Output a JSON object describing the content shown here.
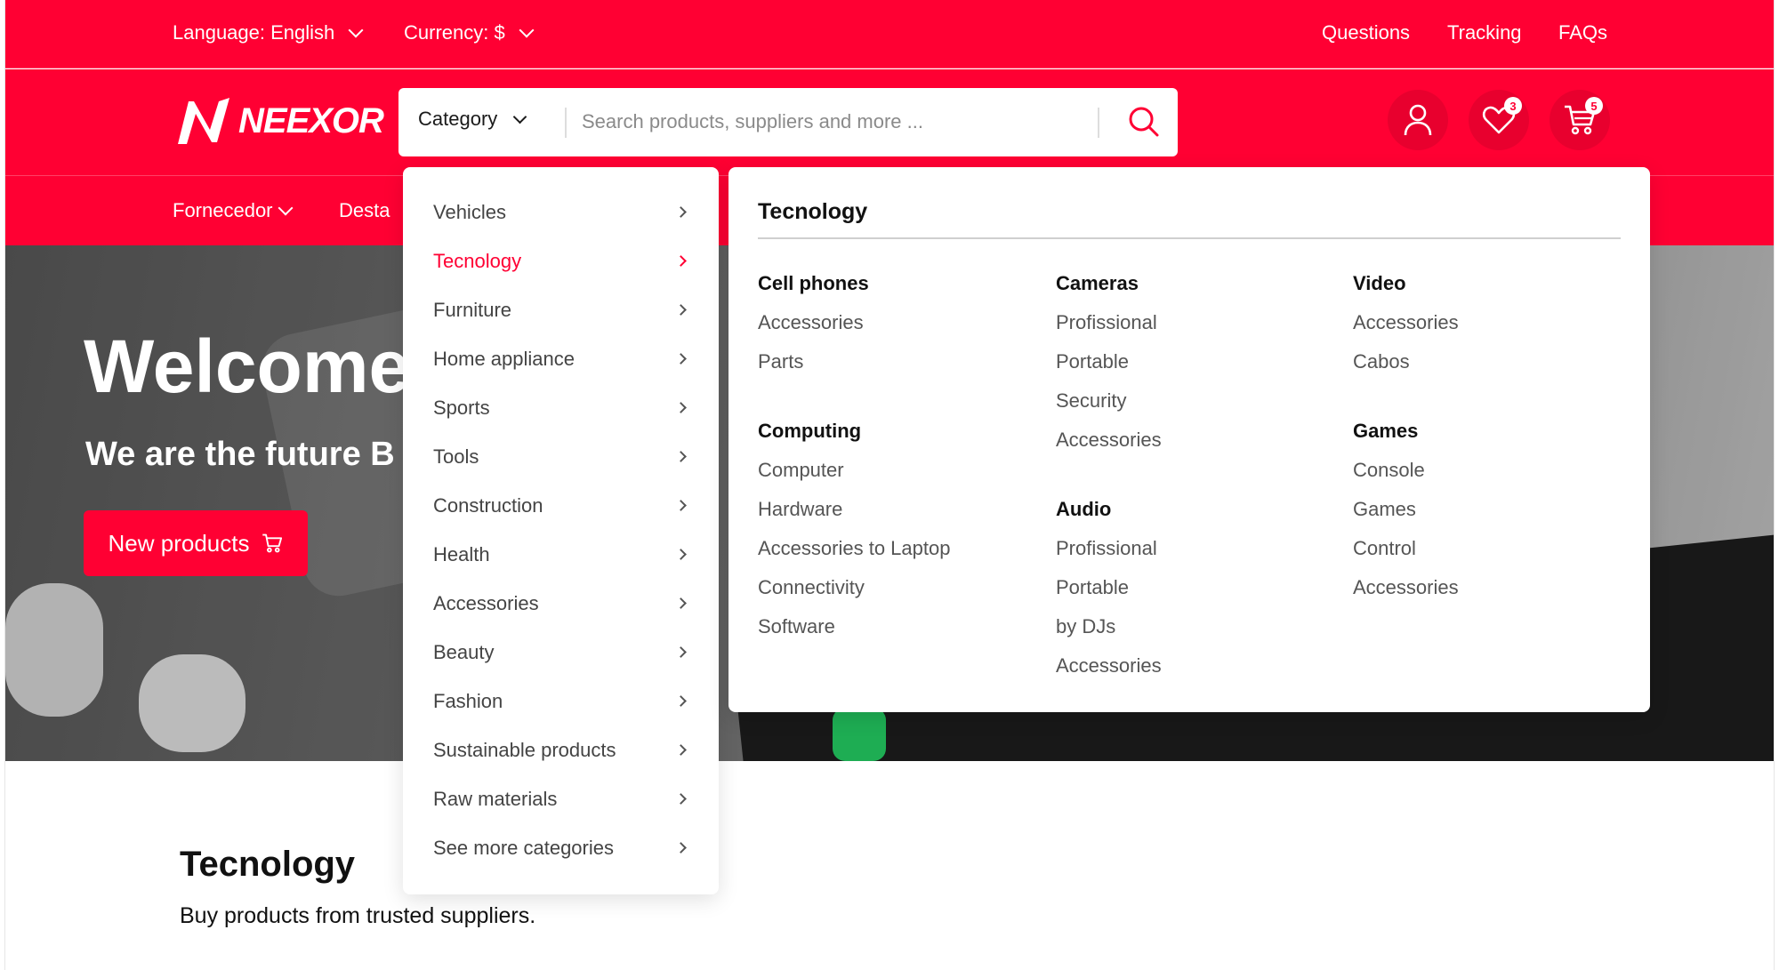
{
  "topbar": {
    "language": "Language: English",
    "currency": "Currency: $",
    "links": [
      "Questions",
      "Tracking",
      "FAQs"
    ]
  },
  "header": {
    "logo": "NEEXOR",
    "category_button": "Category",
    "search_placeholder": "Search products, suppliers and more ...",
    "wishlist_count": "3",
    "cart_count": "5"
  },
  "nav": {
    "items": [
      "Fornecedor",
      "Desta"
    ]
  },
  "hero": {
    "title": "Welcome",
    "subtitle": "We are the future B",
    "button": "New products"
  },
  "category_menu": {
    "items": [
      "Vehicles",
      "Tecnology",
      "Furniture",
      "Home appliance",
      "Sports",
      "Tools",
      "Construction",
      "Health",
      "Accessories",
      "Beauty",
      "Fashion",
      "Sustainable products",
      "Raw materials",
      "See more categories"
    ],
    "active": "Tecnology"
  },
  "mega_menu": {
    "title": "Tecnology",
    "groups": {
      "cell_phones": {
        "heading": "Cell phones",
        "links": [
          "Accessories",
          "Parts"
        ]
      },
      "computing": {
        "heading": "Computing",
        "links": [
          "Computer",
          "Hardware",
          "Accessories to Laptop",
          "Connectivity",
          "Software"
        ]
      },
      "cameras": {
        "heading": "Cameras",
        "links": [
          "Profissional",
          "Portable",
          "Security",
          "Accessories"
        ]
      },
      "audio": {
        "heading": "Audio",
        "links": [
          "Profissional",
          "Portable",
          "by DJs",
          "Accessories"
        ]
      },
      "video": {
        "heading": "Video",
        "links": [
          "Accessories",
          "Cabos"
        ]
      },
      "games": {
        "heading": "Games",
        "links": [
          "Console",
          "Games",
          "Control",
          "Accessories"
        ]
      }
    }
  },
  "section": {
    "title": "Tecnology",
    "subtitle": "Buy products from trusted suppliers."
  },
  "colors": {
    "brand": "#ff0033",
    "text": "#1a1a1a",
    "muted": "#555555"
  }
}
